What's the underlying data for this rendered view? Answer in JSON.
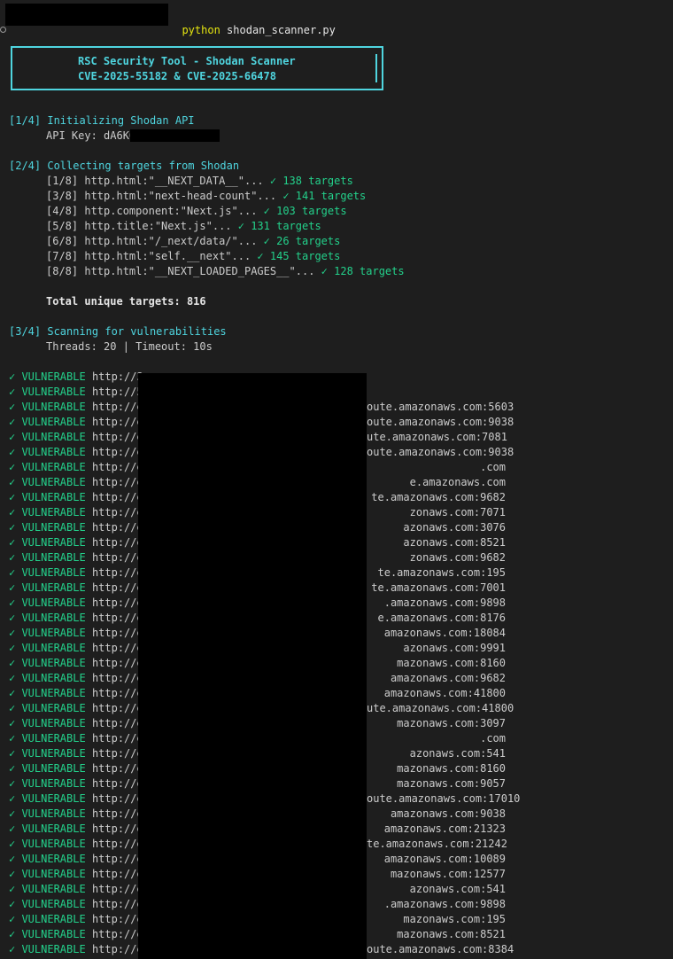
{
  "prompt": {
    "command": "python",
    "script": "shodan_scanner.py"
  },
  "banner": {
    "line1": "RSC Security Tool - Shodan Scanner",
    "line2": "CVE-2025-55182 & CVE-2025-66478"
  },
  "step1": {
    "header": "[1/4] Initializing Shodan API",
    "api_key_label": "API Key: dA6K0"
  },
  "step2": {
    "header": "[2/4] Collecting targets from Shodan",
    "queries": [
      {
        "q": "[1/8] http.html:\"__NEXT_DATA__\"...",
        "r": "✓ 138 targets"
      },
      {
        "q": "[3/8] http.html:\"next-head-count\"...",
        "r": "✓ 141 targets"
      },
      {
        "q": "[4/8] http.component:\"Next.js\"...",
        "r": "✓ 103 targets"
      },
      {
        "q": "[5/8] http.title:\"Next.js\"...",
        "r": "✓ 131 targets"
      },
      {
        "q": "[6/8] http.html:\"/_next/data/\"...",
        "r": "✓ 26 targets"
      },
      {
        "q": "[7/8] http.html:\"self.__next\"...",
        "r": "✓ 145 targets"
      },
      {
        "q": "[8/8] http.html:\"__NEXT_LOADED_PAGES__\"...",
        "r": "✓ 128 targets"
      }
    ],
    "total": "Total unique targets: 816"
  },
  "step3": {
    "header": "[3/4] Scanning for vulnerabilities",
    "config": "Threads: 20 | Timeout: 10s"
  },
  "results": {
    "marker": "✓ VULNERABLE",
    "rows": [
      {
        "prefix": "http://3",
        "suffix": ""
      },
      {
        "prefix": "http://5",
        "suffix": ""
      },
      {
        "prefix": "http://e",
        "suffix": "oute.amazonaws.com:5603"
      },
      {
        "prefix": "http://e",
        "suffix": "oute.amazonaws.com:9038"
      },
      {
        "prefix": "http://e",
        "suffix": "ute.amazonaws.com:7081"
      },
      {
        "prefix": "http://e",
        "suffix": "oute.amazonaws.com:9038"
      },
      {
        "prefix": "http://e",
        "suffix": ".com"
      },
      {
        "prefix": "http://e",
        "suffix": "e.amazonaws.com"
      },
      {
        "prefix": "http://e",
        "suffix": "te.amazonaws.com:9682"
      },
      {
        "prefix": "http://e",
        "suffix": "zonaws.com:7071"
      },
      {
        "prefix": "http://e",
        "suffix": "azonaws.com:3076"
      },
      {
        "prefix": "http://e",
        "suffix": "azonaws.com:8521"
      },
      {
        "prefix": "http://e",
        "suffix": "zonaws.com:9682"
      },
      {
        "prefix": "http://e",
        "suffix": "te.amazonaws.com:195"
      },
      {
        "prefix": "http://e",
        "suffix": "te.amazonaws.com:7001"
      },
      {
        "prefix": "http://e",
        "suffix": ".amazonaws.com:9898"
      },
      {
        "prefix": "http://e",
        "suffix": "e.amazonaws.com:8176"
      },
      {
        "prefix": "http://e",
        "suffix": "amazonaws.com:18084"
      },
      {
        "prefix": "http://e",
        "suffix": "azonaws.com:9991"
      },
      {
        "prefix": "http://e",
        "suffix": "mazonaws.com:8160"
      },
      {
        "prefix": "http://e",
        "suffix": "amazonaws.com:9682"
      },
      {
        "prefix": "http://e",
        "suffix": "amazonaws.com:41800"
      },
      {
        "prefix": "http://e",
        "suffix": "ute.amazonaws.com:41800"
      },
      {
        "prefix": "http://e",
        "suffix": "mazonaws.com:3097"
      },
      {
        "prefix": "http://e",
        "suffix": ".com"
      },
      {
        "prefix": "http://e",
        "suffix": "azonaws.com:541"
      },
      {
        "prefix": "http://e",
        "suffix": "mazonaws.com:8160"
      },
      {
        "prefix": "http://e",
        "suffix": "mazonaws.com:9057"
      },
      {
        "prefix": "http://e",
        "suffix": "oute.amazonaws.com:17010"
      },
      {
        "prefix": "http://e",
        "suffix": "amazonaws.com:9038"
      },
      {
        "prefix": "http://e",
        "suffix": "amazonaws.com:21323"
      },
      {
        "prefix": "http://e",
        "suffix": "te.amazonaws.com:21242"
      },
      {
        "prefix": "http://e",
        "suffix": "amazonaws.com:10089"
      },
      {
        "prefix": "http://e",
        "suffix": "mazonaws.com:12577"
      },
      {
        "prefix": "http://e",
        "suffix": "azonaws.com:541"
      },
      {
        "prefix": "http://e",
        "suffix": ".amazonaws.com:9898"
      },
      {
        "prefix": "http://e",
        "suffix": "mazonaws.com:195"
      },
      {
        "prefix": "http://e",
        "suffix": "mazonaws.com:8521"
      },
      {
        "prefix": "http://e",
        "suffix": "oute.amazonaws.com:8384"
      }
    ]
  }
}
